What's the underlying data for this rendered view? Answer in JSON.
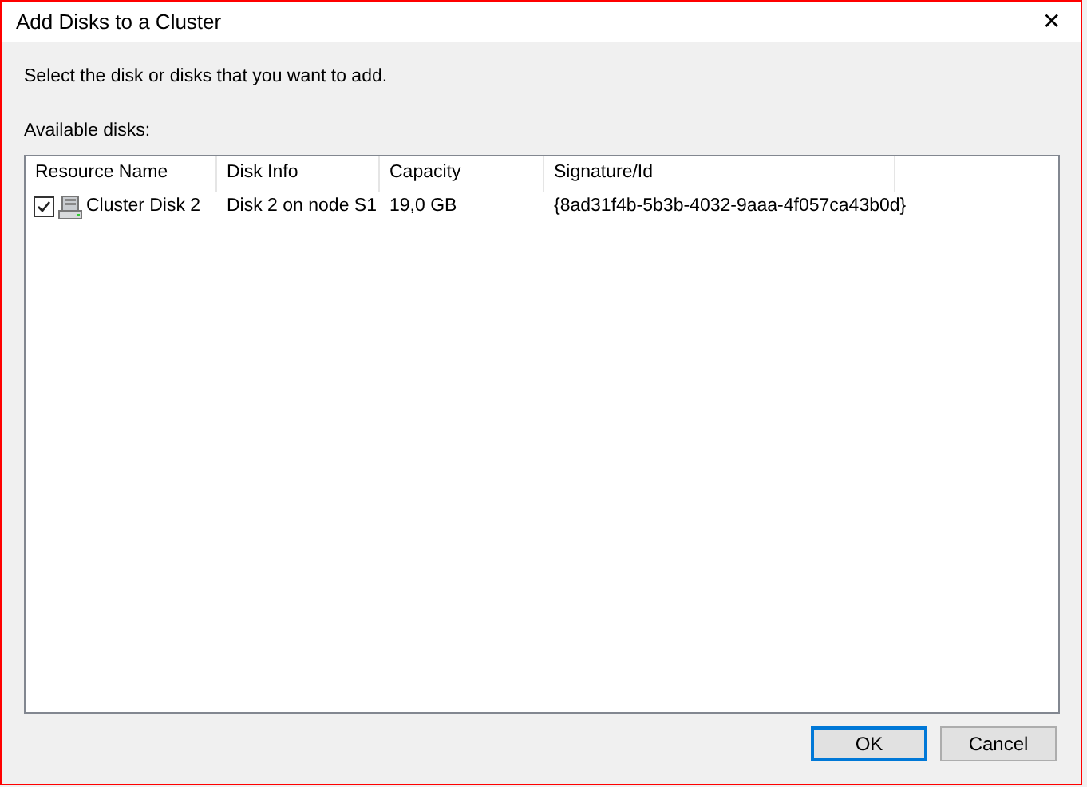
{
  "window": {
    "title": "Add Disks to a Cluster",
    "close": "✕"
  },
  "instruction": "Select the disk or disks that you want to add.",
  "list_label": "Available disks:",
  "table": {
    "columns": [
      "Resource Name",
      "Disk Info",
      "Capacity",
      "Signature/Id"
    ],
    "rows": [
      {
        "checked": true,
        "cells": [
          "Cluster Disk 2",
          "Disk 2 on node S1",
          "19,0 GB",
          "{8ad31f4b-5b3b-4032-9aaa-4f057ca43b0d}"
        ]
      }
    ]
  },
  "buttons": [
    {
      "label": "OK",
      "default": true
    },
    {
      "label": "Cancel",
      "default": false
    }
  ]
}
